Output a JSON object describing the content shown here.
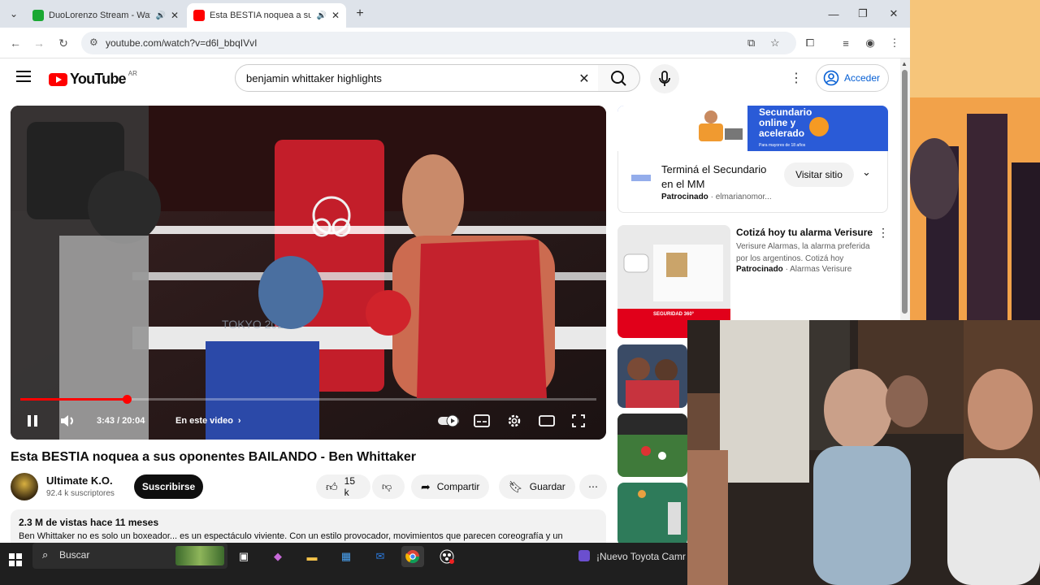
{
  "browser": {
    "tabs": [
      {
        "title": "DuoLorenzo Stream - Watch",
        "favicon_color": "#1aa832",
        "state": "inactive"
      },
      {
        "title": "Esta BESTIA noquea a sus oponentes",
        "favicon_color": "#ff0000",
        "state": "active"
      }
    ],
    "url": "youtube.com/watch?v=d6l_bbqIVvI"
  },
  "youtube": {
    "logo_text": "YouTube",
    "region": "AR",
    "search_query": "benjamin whittaker highlights",
    "signin_label": "Acceder"
  },
  "player": {
    "time": "3:43 / 20:04",
    "progress_fraction": 0.185,
    "chapter_label": "En este video",
    "scene_text": "TOKYO 2020"
  },
  "video": {
    "title": "Esta BESTIA noquea a sus oponentes BAILANDO - Ben Whittaker",
    "channel_name": "Ultimate K.O.",
    "subscribers": "92.4 k suscriptores",
    "subscribe_label": "Suscribirse",
    "likes": "15 k",
    "share_label": "Compartir",
    "save_label": "Guardar",
    "views_date": "2.3 M de vistas  hace 11 meses",
    "description": "Ben Whittaker no es solo un boxeador... es un espectáculo viviente. Con un estilo provocador, movimientos que parecen coreografía y un"
  },
  "sidebar": {
    "ad1": {
      "banner_text": "Secundario online y acelerado",
      "banner_subtext": "Para mayores de 18 años",
      "title": "Terminá el Secundario en el MM",
      "sponsored": "Patrocinado",
      "advertiser": "elmarianomor...",
      "cta": "Visitar sitio"
    },
    "ad2": {
      "title": "Cotizá hoy tu alarma Verisure",
      "body": "Verisure Alarmas, la alarma preferida por los argentinos. Cotizá hoy",
      "sponsored": "Patrocinado",
      "advertiser": "Alarmas Verisure",
      "thumb_text": "SEGURIDAD 360°"
    }
  },
  "taskbar": {
    "search_label": "Buscar",
    "news_text": "¡Nuevo Toyota Camr"
  }
}
